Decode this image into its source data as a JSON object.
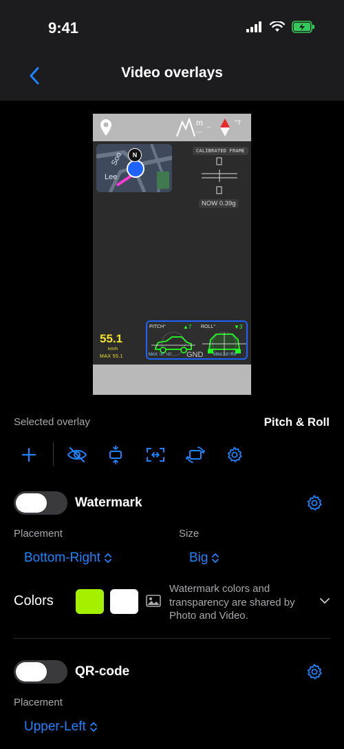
{
  "status": {
    "time": "9:41"
  },
  "nav": {
    "title": "Video overlays"
  },
  "preview": {
    "map_street": "Lee",
    "map_street_2": "Soo",
    "compass": "N",
    "alt_unit": "m",
    "alt_value": "---",
    "alt_dash": "_",
    "bearing": "°T",
    "calibrated": "CALIBRATED FRAME",
    "now": "NOW 0.39g",
    "speed": "55.1",
    "speed_unit": "km/h",
    "speed_max": "MAX 55.1",
    "pitch_label": "PITCH°",
    "pitch_value": "▲7",
    "roll_label": "ROLL°",
    "roll_value": "▼3",
    "pitch_max": "MAX ↑0° ↓0°",
    "roll_max": "MAX L0° R0°",
    "gnd": "GND"
  },
  "selected": {
    "label": "Selected overlay",
    "value": "Pitch & Roll"
  },
  "watermark": {
    "title": "Watermark",
    "placement_label": "Placement",
    "placement_value": "Bottom-Right",
    "size_label": "Size",
    "size_value": "Big",
    "colors_label": "Colors",
    "color_1": "#a4f000",
    "color_2": "#ffffff",
    "note": "Watermark colors and transparency are shared by Photo and Video."
  },
  "qr": {
    "title": "QR-code",
    "placement_label": "Placement",
    "placement_value": "Upper-Left"
  },
  "colors": {
    "accent": "#1e84ff",
    "background": "#000000",
    "bar": "#1c1c1e"
  },
  "icons": [
    "back-chevron-icon",
    "add-icon",
    "eye-slash-icon",
    "align-vertical-icon",
    "resize-icon",
    "rotate-icon",
    "gear-icon",
    "image-icon",
    "chevron-down-icon"
  ]
}
